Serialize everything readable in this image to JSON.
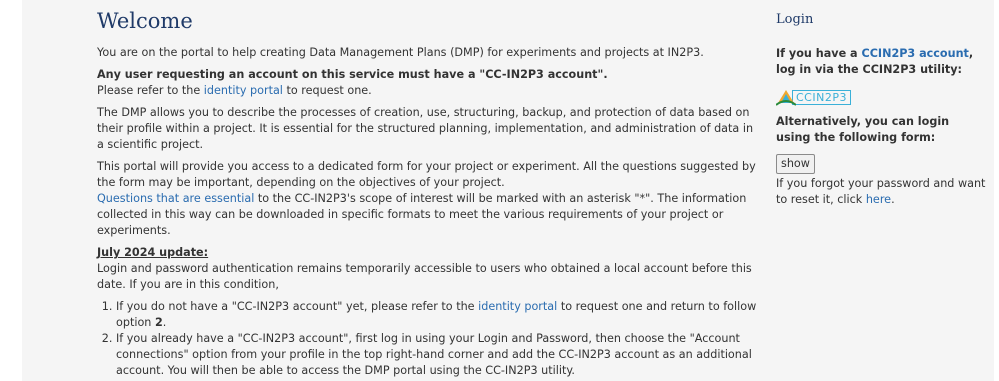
{
  "main": {
    "title": "Welcome",
    "intro": "You are on the portal to help creating Data Management Plans (DMP) for experiments and projects at IN2P3.",
    "notice_bold": "Any user requesting an account on this service must have a \"CC-IN2P3 account\".",
    "notice_pre": "Please refer to the ",
    "notice_link": "identity portal",
    "notice_post": " to request one.",
    "desc1": "The DMP allows you to describe the processes of creation, use, structuring, backup, and protection of data based on their profile within a project. It is essential for the structured planning, implementation, and administration of data in a scientific project.",
    "desc2": "This portal will provide you access to a dedicated form for your project or experiment. All the questions suggested by the form may be important, depending on the objectives of your project.",
    "desc3_link": "Questions that are essential",
    "desc3_rest": " to the CC-IN2P3's scope of interest will be marked with an asterisk \"*\". The information collected in this way can be downloaded in specific formats to meet the various requirements of your project or experiments.",
    "update_heading": "July 2024 update:",
    "update_text": "Login and password authentication remains temporarily accessible to users who obtained a local account before this date. If you are in this condition,",
    "step1_pre": "If you do not have a \"CC-IN2P3 account\" yet, please refer to the ",
    "step1_link": "identity portal",
    "step1_mid": " to request one and return to follow option ",
    "step1_num": "2",
    "step1_end": ".",
    "step2": "If you already have a \"CC-IN2P3 account\", first log in using your Login and Password, then choose the \"Account connections\" option from your profile in the top right-hand corner and add the CC-IN2P3 account as an additional account. You will then be able to access the DMP portal using the CC-IN2P3 utility."
  },
  "aside": {
    "title": "Login",
    "cc_pre": "If you have a ",
    "cc_link": "CCIN2P3 account",
    "cc_post": ", log in via the CCIN2P3 utility:",
    "logo_text": "CCIN2P3",
    "alt_text": "Alternatively, you can login using the following form:",
    "show_label": "show",
    "forgot_pre": "If you forgot your password and want to reset it, click ",
    "forgot_link": "here",
    "forgot_post": "."
  },
  "colors": {
    "accent": "#1f3a68",
    "link": "#2a6cb0",
    "logo": "#3ab0d8"
  }
}
